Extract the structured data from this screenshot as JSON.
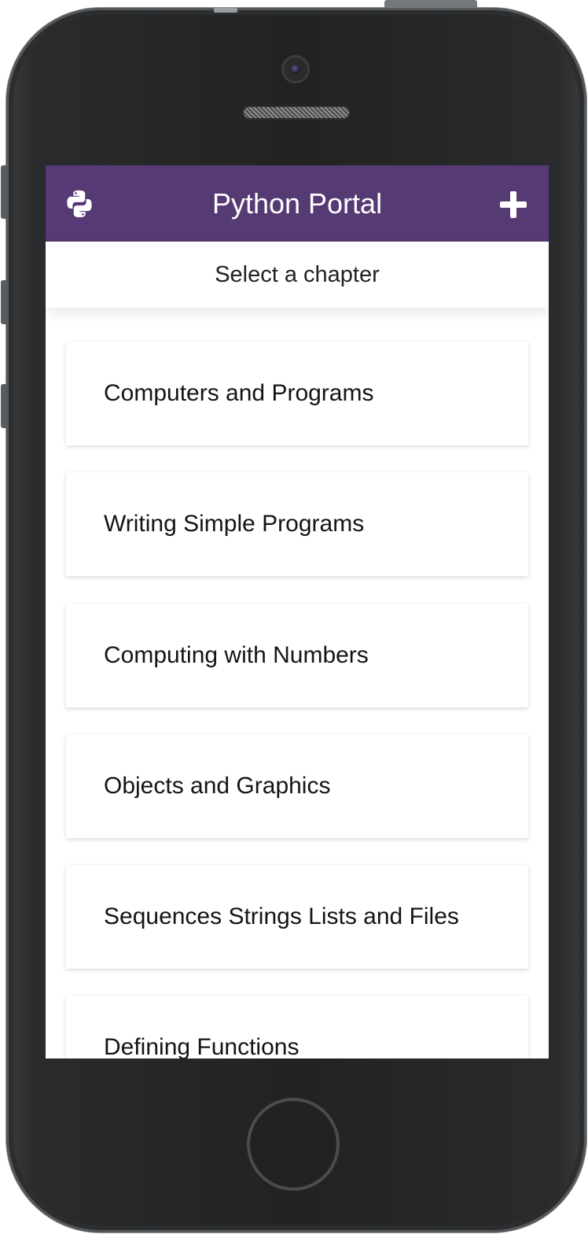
{
  "app": {
    "title": "Python Portal",
    "subtitle": "Select a chapter",
    "logo_icon": "python-logo-icon",
    "add_icon": "plus-icon",
    "colors": {
      "appbar": "#553a74",
      "logo": "#ffffff"
    }
  },
  "chapters": [
    {
      "label": "Computers and Programs"
    },
    {
      "label": "Writing Simple Programs"
    },
    {
      "label": "Computing with Numbers"
    },
    {
      "label": "Objects and Graphics"
    },
    {
      "label": "Sequences Strings Lists and Files"
    },
    {
      "label": "Defining Functions"
    }
  ]
}
